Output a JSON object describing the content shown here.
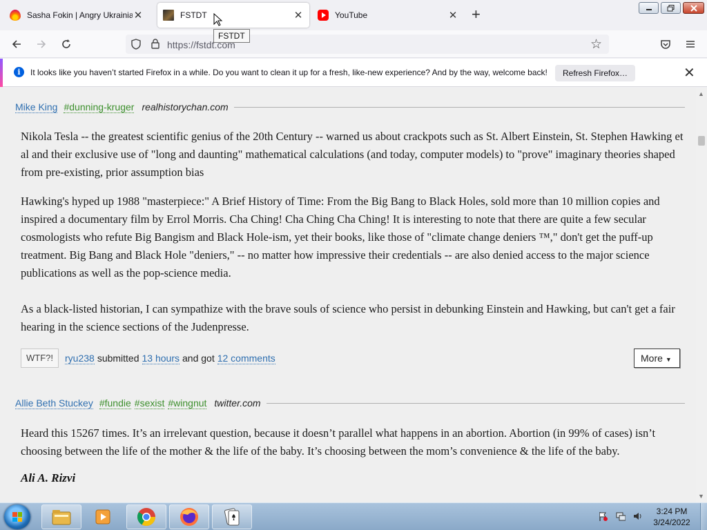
{
  "browser": {
    "tabs": [
      {
        "title": "Sasha Fokin | Angry Ukrainian K",
        "icon": "firefox-flame-icon",
        "active": false
      },
      {
        "title": "FSTDT",
        "icon": "fstdt-favicon",
        "active": true
      },
      {
        "title": "YouTube",
        "icon": "youtube-icon",
        "active": false
      }
    ],
    "new_tab_glyph": "+",
    "tooltip": "FSTDT",
    "url": "https://fstdt.com"
  },
  "notification": {
    "message": "It looks like you haven’t started Firefox in a while. Do you want to clean it up for a fresh, like-new experience? And by the way, welcome back!",
    "button_label": "Refresh Firefox…"
  },
  "entries": [
    {
      "author": "Mike King",
      "tags": [
        "#dunning-kruger"
      ],
      "source": "realhistorychan.com",
      "paragraphs": [
        "Nikola Tesla -- the greatest scientific genius of the 20th Century -- warned us about crackpots such as St. Albert Einstein, St. Stephen Hawking et al and their exclusive use of \"long and daunting\" mathematical calculations (and today, computer models) to \"prove\" imaginary theories shaped from pre-existing, prior assumption bias",
        "Hawking's hyped up 1988 \"masterpiece:\" A Brief History of Time: From the Big Bang to Black Holes, sold more than 10 million copies and inspired a documentary film by Errol Morris. Cha Ching! Cha Ching Cha Ching! It is interesting to note that there are quite a few secular cosmologists who refute Big Bangism and Black Hole-ism, yet their books, like those of \"climate change deniers ™,\" don't get the puff-up treatment. Big Bang and Black Hole \"deniers,\" -- no matter how impressive their credentials -- are also denied access to the major science publications as well as the pop-science media.",
        "As a black-listed historian, I can sympathize with the brave souls of science who persist in debunking Einstein and Hawking, but can't get a fair hearing in the science sections of the Judenpresse."
      ],
      "footer": {
        "wtf_label": "WTF?!",
        "submitter": "ryu238",
        "submitted_text": "submitted",
        "time": "13 hours",
        "and_got_text": "and got",
        "comments": "12 comments",
        "more_label": "More"
      }
    },
    {
      "author": "Allie Beth Stuckey",
      "tags": [
        "#fundie",
        "#sexist",
        "#wingnut"
      ],
      "source": "twitter.com",
      "paragraphs": [
        "Heard this 15267 times. It’s an irrelevant question, because it doesn’t parallel what happens in an abortion. Abortion (in 99% of cases) isn’t choosing between the life of the mother & the life of the baby. It’s choosing between the mom’s convenience & the life of the baby."
      ],
      "quoted_author": "Ali A. Rizvi"
    }
  ],
  "taskbar": {
    "time": "3:24 PM",
    "date": "3/24/2022",
    "apps": [
      "file-explorer-icon",
      "media-player-icon",
      "chrome-icon",
      "firefox-icon",
      "solitaire-icon"
    ]
  }
}
